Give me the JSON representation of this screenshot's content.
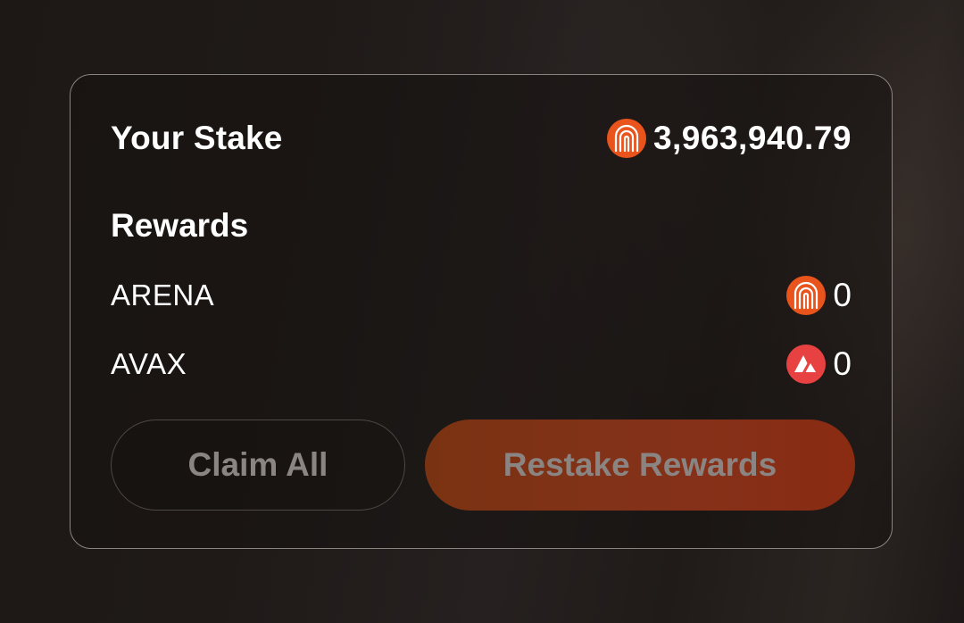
{
  "stake": {
    "label": "Your Stake",
    "token_icon": "arena-token-icon",
    "value": "3,963,940.79"
  },
  "rewards": {
    "heading": "Rewards",
    "items": [
      {
        "label": "ARENA",
        "icon": "arena-token-icon",
        "value": "0",
        "color": "#e9541d"
      },
      {
        "label": "AVAX",
        "icon": "avax-token-icon",
        "value": "0",
        "color": "#e84142"
      }
    ]
  },
  "actions": {
    "claim_label": "Claim All",
    "restake_label": "Restake Rewards"
  },
  "colors": {
    "accent": "#e9541d",
    "avax": "#e84142"
  }
}
